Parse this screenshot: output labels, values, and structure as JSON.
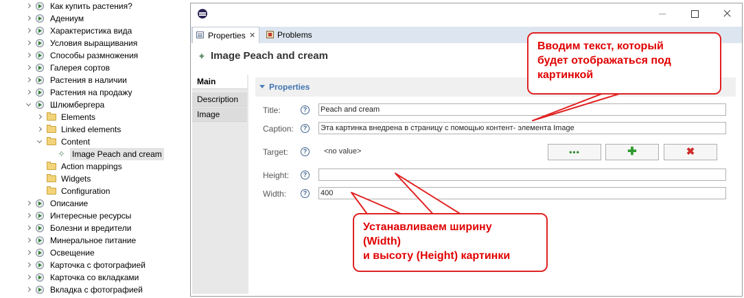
{
  "tree": {
    "items": [
      {
        "label": "Как купить растения?",
        "kind": "page",
        "indent": 0,
        "state": "collapsed"
      },
      {
        "label": "Адениум",
        "kind": "page",
        "indent": 0,
        "state": "collapsed"
      },
      {
        "label": "Характеристика вида",
        "kind": "page",
        "indent": 0,
        "state": "collapsed"
      },
      {
        "label": "Условия выращивания",
        "kind": "page",
        "indent": 0,
        "state": "collapsed"
      },
      {
        "label": "Способы размножения",
        "kind": "page",
        "indent": 0,
        "state": "collapsed"
      },
      {
        "label": "Галерея сортов",
        "kind": "page",
        "indent": 0,
        "state": "collapsed"
      },
      {
        "label": "Растения в наличии",
        "kind": "page",
        "indent": 0,
        "state": "collapsed"
      },
      {
        "label": "Растения на продажу",
        "kind": "page",
        "indent": 0,
        "state": "collapsed"
      },
      {
        "label": "Шлюмбергера",
        "kind": "page",
        "indent": 0,
        "state": "expanded"
      },
      {
        "label": "Elements",
        "kind": "folder",
        "indent": 1,
        "state": "collapsed"
      },
      {
        "label": "Linked elements",
        "kind": "folder",
        "indent": 1,
        "state": "collapsed"
      },
      {
        "label": "Content",
        "kind": "folder",
        "indent": 1,
        "state": "expanded"
      },
      {
        "label": "Image Peach and cream",
        "kind": "element",
        "indent": 2,
        "state": "none",
        "selected": true
      },
      {
        "label": "Action mappings",
        "kind": "folder",
        "indent": 1,
        "state": "none"
      },
      {
        "label": "Widgets",
        "kind": "folder",
        "indent": 1,
        "state": "none"
      },
      {
        "label": "Configuration",
        "kind": "folder",
        "indent": 1,
        "state": "none"
      },
      {
        "label": "Описание",
        "kind": "page",
        "indent": 0,
        "state": "collapsed"
      },
      {
        "label": "Интересные ресурсы",
        "kind": "page",
        "indent": 0,
        "state": "collapsed"
      },
      {
        "label": "Болезни и вредители",
        "kind": "page",
        "indent": 0,
        "state": "collapsed"
      },
      {
        "label": "Минеральное питание",
        "kind": "page",
        "indent": 0,
        "state": "collapsed"
      },
      {
        "label": "Освещение",
        "kind": "page",
        "indent": 0,
        "state": "collapsed"
      },
      {
        "label": "Карточка с фотографией",
        "kind": "page",
        "indent": 0,
        "state": "collapsed"
      },
      {
        "label": "Карточка со вкладками",
        "kind": "page",
        "indent": 0,
        "state": "collapsed"
      },
      {
        "label": "Вкладка с фотографией",
        "kind": "page",
        "indent": 0,
        "state": "collapsed"
      }
    ]
  },
  "window": {
    "tabs": {
      "properties": "Properties",
      "problems": "Problems"
    },
    "header_title": "Image Peach and cream",
    "side_tabs": {
      "main": "Main",
      "description": "Description",
      "image": "Image"
    },
    "section_title": "Properties",
    "fields": {
      "title_label": "Title:",
      "title_value": "Peach and cream",
      "caption_label": "Caption:",
      "caption_value": "Эта картинка внедрена в страницу с помощью контент- элемента Image",
      "target_label": "Target:",
      "target_value": "<no value>",
      "height_label": "Height:",
      "height_value": "",
      "width_label": "Width:",
      "width_value": "400"
    },
    "buttons": {
      "browse": "•••",
      "add": "✚",
      "remove": "✖"
    },
    "help_glyph": "?"
  },
  "annotations": {
    "top": {
      "line1": "Вводим текст, который",
      "line2": "будет отображаться под",
      "line3": "картинкой"
    },
    "bottom": {
      "line1": "Устанавливаем ширину",
      "line2": "(Width)",
      "line3": "и высоту (Height) картинки"
    },
    "color": "#e02020"
  },
  "colors": {
    "tab_bar": "#dde6f0",
    "section_title": "#3f74b0",
    "selection": "#e3e3e3"
  }
}
